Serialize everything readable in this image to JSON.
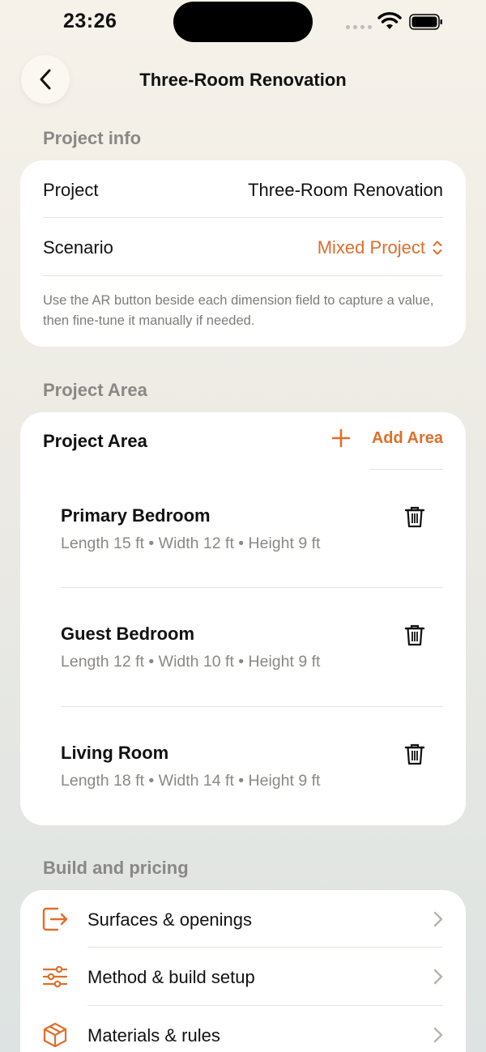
{
  "status": {
    "time": "23:26"
  },
  "nav": {
    "title": "Three-Room Renovation"
  },
  "project_info": {
    "header": "Project info",
    "project_label": "Project",
    "project_value": "Three-Room Renovation",
    "scenario_label": "Scenario",
    "scenario_value": "Mixed Project",
    "note": "Use the AR button beside each dimension field to capture a value, then fine-tune it manually if needed."
  },
  "project_area": {
    "header": "Project Area",
    "card_title": "Project Area",
    "add_label": "Add Area",
    "rooms": [
      {
        "name": "Primary Bedroom",
        "dims": "Length 15 ft • Width 12 ft • Height 9 ft"
      },
      {
        "name": "Guest Bedroom",
        "dims": "Length 12 ft • Width 10 ft • Height 9 ft"
      },
      {
        "name": "Living Room",
        "dims": "Length 18 ft • Width 14 ft • Height 9 ft"
      }
    ]
  },
  "build": {
    "header": "Build and pricing",
    "items": [
      {
        "label": "Surfaces & openings",
        "icon": "door-exit-icon"
      },
      {
        "label": "Method & build setup",
        "icon": "sliders-icon"
      },
      {
        "label": "Materials & rules",
        "icon": "cube-icon"
      }
    ]
  },
  "colors": {
    "accent": "#e06e2b",
    "secondary_text": "#8a8884"
  }
}
